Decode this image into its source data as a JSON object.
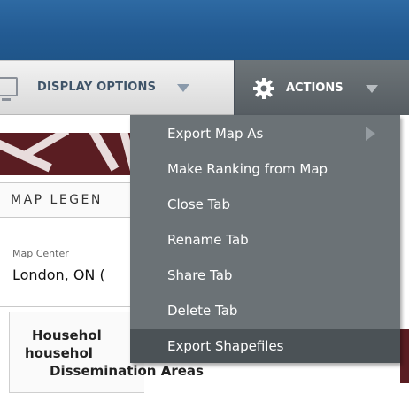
{
  "toolbar": {
    "display_options_label": "DISPLAY OPTIONS",
    "actions_label": "ACTIONS"
  },
  "map_legend": {
    "header": "MAP LEGEN",
    "center_label": "Map Center",
    "center_value": "London, ON (",
    "title_line1": "Househol",
    "title_line2": "househol",
    "title_line3": "Dissemination Areas"
  },
  "actions_menu": {
    "items": [
      {
        "label": "Export Map As",
        "has_submenu": true
      },
      {
        "label": "Make Ranking from Map"
      },
      {
        "label": "Close Tab"
      },
      {
        "label": "Rename Tab"
      },
      {
        "label": "Share Tab"
      },
      {
        "label": "Delete Tab"
      },
      {
        "label": "Export Shapefiles",
        "highlighted": true
      }
    ]
  },
  "colors": {
    "header_blue": "#2e6aa3",
    "menu_bg": "#6b7276",
    "menu_highlight": "#4b5256",
    "map_dark_red": "#5a1d22"
  }
}
